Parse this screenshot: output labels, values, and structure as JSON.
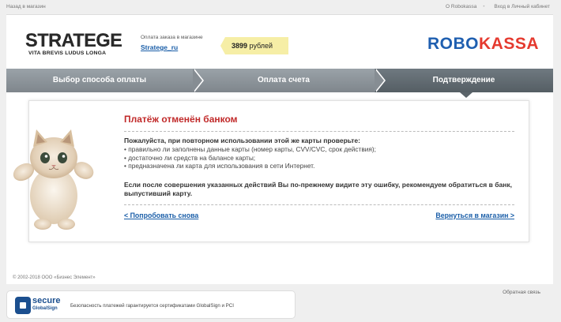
{
  "topbar": {
    "back_link": "Назад в магазин",
    "about_link": "О Robokassa",
    "cabinet_link": "Вход в Личный кабинет"
  },
  "header": {
    "logo_text": "STRATEGE",
    "logo_motto": "VITA BREVIS LUDUS LONGA",
    "order_label": "Оплата заказа в магазине",
    "shop_name": "Strategе_ru",
    "price_amount": "3899",
    "price_currency": "рублей",
    "brand_left": "ROBO",
    "brand_right": "KASSA"
  },
  "steps": [
    {
      "label": "Выбор способа оплаты"
    },
    {
      "label": "Оплата счета"
    },
    {
      "label": "Подтверждение"
    }
  ],
  "message": {
    "title": "Платёж отменён банком",
    "lead": "Пожалуйста, при повторном использовании этой же карты проверьте:",
    "checks": [
      "правильно ли заполнены данные карты (номер карты, CVV/CVC, срок действия);",
      "достаточно ли средств на балансе карты;",
      "предназначена ли карта для использования в сети Интернет."
    ],
    "notice": "Если после совершения указанных действий Вы по-прежнему видите эту ошибку, рекомендуем обратиться в банк, выпустивший карту.",
    "retry_link": "< Попробовать снова",
    "return_link": "Вернуться в магазин >"
  },
  "footer": {
    "copyright": "© 2002-2018 ООО «Бизнес Элемент»",
    "feedback": "Обратная связь",
    "secure_word": "secure",
    "secure_brand": "GlobalSign",
    "secure_text": "Безопасность платежей гарантируется сертификатами GlobalSign и PCI"
  },
  "colors": {
    "brand_blue": "#1f5fb0",
    "brand_red": "#e53a2f",
    "error_red": "#c12a2a",
    "price_bg": "#f6eea6",
    "step_active": "#5a6369"
  }
}
